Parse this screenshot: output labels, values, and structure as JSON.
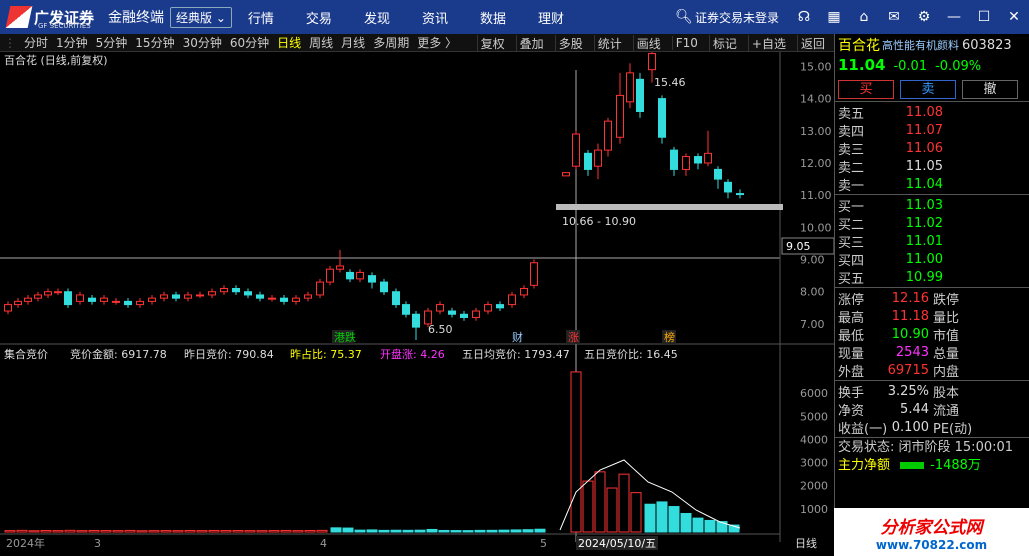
{
  "app": {
    "logo": "广发证券",
    "logo_sub": "GF SECURITIES",
    "product": "金融终端",
    "edition": "经典版"
  },
  "menu": [
    "行情",
    "交易",
    "发现",
    "资讯",
    "数据",
    "理财"
  ],
  "login": "证券交易未登录",
  "periods": [
    "分时",
    "1分钟",
    "5分钟",
    "15分钟",
    "30分钟",
    "60分钟",
    "日线",
    "周线",
    "月线",
    "多周期",
    "更多 〉"
  ],
  "active_period": "日线",
  "toolbar_right": [
    "复权",
    "叠加",
    "多股",
    "统计",
    "画线",
    "F10",
    "标记",
    "+自选",
    "返回"
  ],
  "chart_title": "百合花 (日线,前复权)",
  "price_labels": {
    "high": "15.46",
    "low": "6.50",
    "cursor": "9.05",
    "range": "10.66 - 10.90"
  },
  "markers": [
    "港跌",
    "财",
    "涨",
    "榜"
  ],
  "indicator": {
    "name": "集合竞价",
    "items": [
      {
        "label": "竞价金额: 6917.78",
        "arrow": "↑",
        "color": "#ddd"
      },
      {
        "label": "昨日竞价: 790.84",
        "arrow": "↑",
        "color": "#ddd"
      },
      {
        "label": "昨占比: 75.37",
        "arrow": "↑",
        "color": "#ff0"
      },
      {
        "label": "开盘涨: 4.26",
        "arrow": "↓",
        "color": "#f3f"
      },
      {
        "label": "五日均竞价: 1793.47",
        "arrow": "↑",
        "color": "#ddd"
      },
      {
        "label": "五日竞价比: 16.45",
        "arrow": "↑",
        "color": "#ddd"
      }
    ]
  },
  "x_labels": {
    "year": "2024年",
    "m3": "3",
    "m4": "4",
    "m5": "5",
    "date": "2024/05/10/五",
    "period_tab": "日线"
  },
  "price_axis": [
    "15.00",
    "14.00",
    "13.00",
    "12.00",
    "11.00",
    "10.00",
    "9.00",
    "8.00",
    "7.00"
  ],
  "vol_axis": [
    "6000",
    "5000",
    "4000",
    "3000",
    "2000",
    "1000"
  ],
  "stock": {
    "name": "百合花",
    "concept": "高性能有机颜料",
    "code": "603823",
    "price": "11.04",
    "change": "-0.01",
    "pct": "-0.09%"
  },
  "trade_buttons": [
    "买",
    "卖",
    "撤"
  ],
  "asks": [
    {
      "l": "卖五",
      "p": "11.08",
      "c": "red"
    },
    {
      "l": "卖四",
      "p": "11.07",
      "c": "red"
    },
    {
      "l": "卖三",
      "p": "11.06",
      "c": "red"
    },
    {
      "l": "卖二",
      "p": "11.05",
      "c": "white"
    },
    {
      "l": "卖一",
      "p": "11.04",
      "c": "green"
    }
  ],
  "bids": [
    {
      "l": "买一",
      "p": "11.03",
      "c": "green"
    },
    {
      "l": "买二",
      "p": "11.02",
      "c": "green"
    },
    {
      "l": "买三",
      "p": "11.01",
      "c": "green"
    },
    {
      "l": "买四",
      "p": "11.00",
      "c": "green"
    },
    {
      "l": "买五",
      "p": "10.99",
      "c": "green"
    }
  ],
  "stats1": [
    {
      "l": "涨停",
      "v": "12.16",
      "c": "red",
      "l2": "跌停"
    },
    {
      "l": "最高",
      "v": "11.18",
      "c": "red",
      "l2": "量比"
    },
    {
      "l": "最低",
      "v": "10.90",
      "c": "green",
      "l2": "市值"
    },
    {
      "l": "现量",
      "v": "2543",
      "c": "mag",
      "l2": "总量"
    },
    {
      "l": "外盘",
      "v": "69715",
      "c": "red",
      "l2": "内盘"
    }
  ],
  "stats2": [
    {
      "l": "换手",
      "v": "3.25%",
      "c": "white",
      "l2": "股本"
    },
    {
      "l": "净资",
      "v": "5.44",
      "c": "white",
      "l2": "流通"
    },
    {
      "l": "收益(一)",
      "v": "0.100",
      "c": "white",
      "l2": "PE(动)"
    }
  ],
  "trade_status": "交易状态: 闭市阶段 15:00:01",
  "net_inflow": {
    "label": "主力净额",
    "value": "-1488万"
  },
  "watermark": {
    "text": "分析家公式网",
    "url": "www.70822.com"
  },
  "colors": {
    "up": "#ff3333",
    "down": "#33dddd",
    "bg": "#000000",
    "topbar": "#1a3a8c"
  }
}
